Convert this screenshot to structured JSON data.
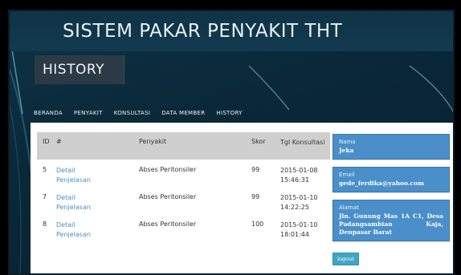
{
  "header": {
    "site_title": "SISTEM PAKAR PENYAKIT THT"
  },
  "page": {
    "title": "HISTORY"
  },
  "nav": {
    "items": [
      "BERANDA",
      "PENYAKIT",
      "KONSULTASI",
      "DATA MEMBER",
      "HISTORY"
    ]
  },
  "table": {
    "headers": {
      "id": "ID",
      "hash": "#",
      "penyakit": "Penyakit",
      "skor": "Skor",
      "tgl": "Tgl Konsultasi"
    },
    "rows": [
      {
        "id": "5",
        "link_line1": "Detail",
        "link_line2": "Penjelasan",
        "penyakit": "Abses Peritonsiler",
        "skor": "99",
        "date": "2015-01-08",
        "time": "15:46:31"
      },
      {
        "id": "7",
        "link_line1": "Detail",
        "link_line2": "Penjelasan",
        "penyakit": "Abses Peritonsiler",
        "skor": "99",
        "date": "2015-01-10",
        "time": "14:22:25"
      },
      {
        "id": "8",
        "link_line1": "Detail",
        "link_line2": "Penjelasan",
        "penyakit": "Abses Peritonsiler",
        "skor": "100",
        "date": "2015-01-10",
        "time": "18:01:44"
      }
    ]
  },
  "profile": {
    "nama_label": "Nama",
    "nama_value": "Jeka",
    "email_label": "Email",
    "email_value": "gede_ferdika@yahoo.com",
    "alamat_label": "Alamat",
    "alamat_value": "Jln. Gunung Mas 1A C1, Desa Padangsambian Kaja, Denpasar Barat",
    "logout_label": "logout"
  },
  "colors": {
    "accent": "#4a8fc9",
    "header_bg": "#0d3346",
    "link": "#4b8fc4"
  }
}
